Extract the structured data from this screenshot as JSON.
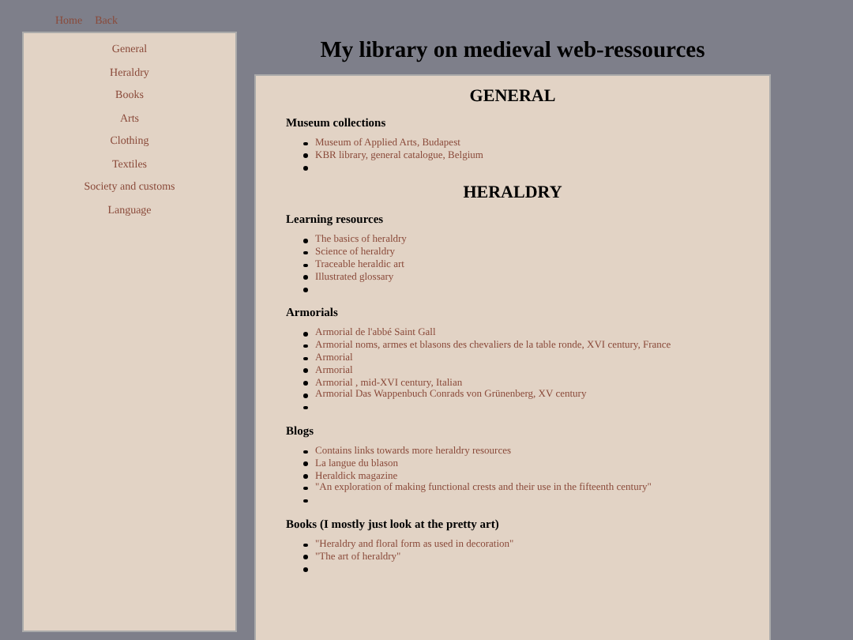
{
  "top_nav": [
    {
      "label": "Home"
    },
    {
      "label": "Back"
    }
  ],
  "sidebar": {
    "items": [
      {
        "label": "General"
      },
      {
        "label": "Heraldry"
      },
      {
        "label": "Books"
      },
      {
        "label": "Arts"
      },
      {
        "label": "Clothing"
      },
      {
        "label": "Textiles"
      },
      {
        "label": "Society and customs"
      },
      {
        "label": "Language"
      }
    ]
  },
  "page_title": "My library on medieval web-ressources",
  "sections": [
    {
      "title": "GENERAL",
      "groups": [
        {
          "heading": "Museum collections",
          "trailing_empty_bullet": true,
          "links": [
            "Museum of Applied Arts, Budapest",
            "KBR library, general catalogue, Belgium"
          ]
        }
      ]
    },
    {
      "title": "HERALDRY",
      "groups": [
        {
          "heading": "Learning resources",
          "trailing_empty_bullet": true,
          "links": [
            "The basics of heraldry",
            "Science of heraldry",
            "Traceable heraldic art",
            "Illustrated glossary"
          ]
        },
        {
          "heading": "Armorials",
          "trailing_empty_bullet": true,
          "links": [
            "Armorial de l'abbé Saint Gall",
            "Armorial noms, armes et blasons des chevaliers de la table ronde, XVI century, France",
            "Armorial",
            "Armorial",
            "Armorial , mid-XVI century, Italian",
            "Armorial Das Wappenbuch Conrads von Grünenberg, XV century"
          ]
        },
        {
          "heading": "Blogs",
          "trailing_empty_bullet": true,
          "links": [
            "Contains links towards more heraldry resources",
            "La langue du blason",
            "Heraldick magazine",
            "\"An exploration of making functional crests and their use in the fifteenth century\""
          ]
        },
        {
          "heading": "Books (I mostly just look at the pretty art)",
          "trailing_empty_bullet": true,
          "links": [
            "\"Heraldry and floral form as used in decoration\"",
            "\"The art of heraldry\""
          ]
        }
      ]
    }
  ]
}
